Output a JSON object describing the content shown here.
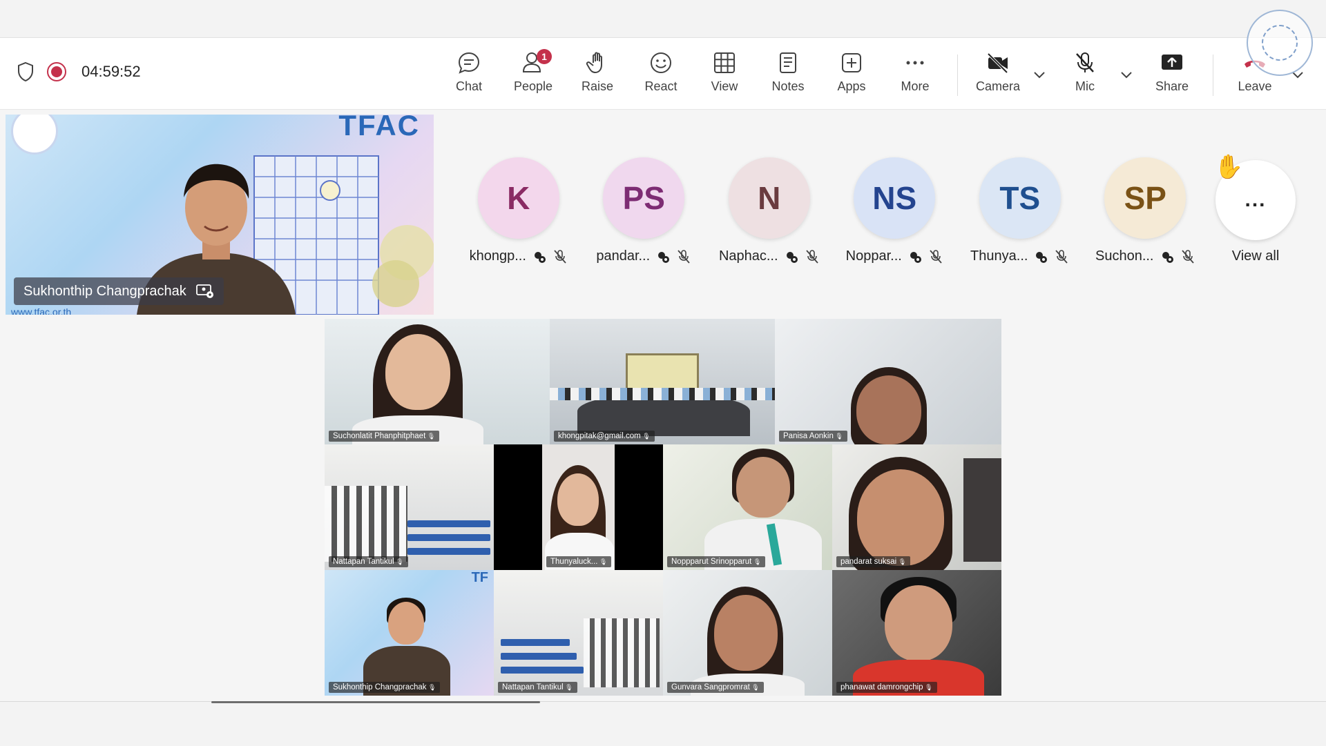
{
  "toolbar": {
    "timer": "04:59:52",
    "buttons": {
      "chat": "Chat",
      "people": "People",
      "people_badge": "1",
      "raise": "Raise",
      "react": "React",
      "view": "View",
      "notes": "Notes",
      "apps": "Apps",
      "more": "More",
      "camera": "Camera",
      "mic": "Mic",
      "share": "Share",
      "leave": "Leave"
    }
  },
  "speaker": {
    "name": "Sukhonthip Changprachak",
    "banner_text": "TFAC",
    "url_text": "www.tfac.or.th"
  },
  "participants": [
    {
      "initials": "K",
      "name": "khongp...",
      "bg": "#f3d7ec",
      "fg": "#8a2b64"
    },
    {
      "initials": "PS",
      "name": "pandar...",
      "bg": "#f0d8ee",
      "fg": "#7d2c73"
    },
    {
      "initials": "N",
      "name": "Naphac...",
      "bg": "#eee0e2",
      "fg": "#6a3b3f"
    },
    {
      "initials": "NS",
      "name": "Noppar...",
      "bg": "#d9e3f6",
      "fg": "#24448f"
    },
    {
      "initials": "TS",
      "name": "Thunya...",
      "bg": "#dbe6f5",
      "fg": "#1f4f8f"
    },
    {
      "initials": "SP",
      "name": "Suchon...",
      "bg": "#f5ead6",
      "fg": "#7a5216"
    }
  ],
  "view_all": {
    "label": "View all",
    "dots": "..."
  },
  "gallery": {
    "tiles": [
      "Suchonlatit Phanphitphaet",
      "khongpitak@gmail.com",
      "Panisa Aonkin",
      "Nattapan Tantikul",
      "Thunyaluck...",
      "Noppparut Srinopparut",
      "pandarat suksai",
      "Sukhonthip Changprachak",
      "Nattapan Tantikul",
      "Gunvara Sangpromrat",
      "phanawat damrongchip"
    ],
    "watermark": "TF"
  },
  "colors": {
    "record": "#c4314b",
    "leave": "#c4314b",
    "accent": "#2a68b8"
  }
}
